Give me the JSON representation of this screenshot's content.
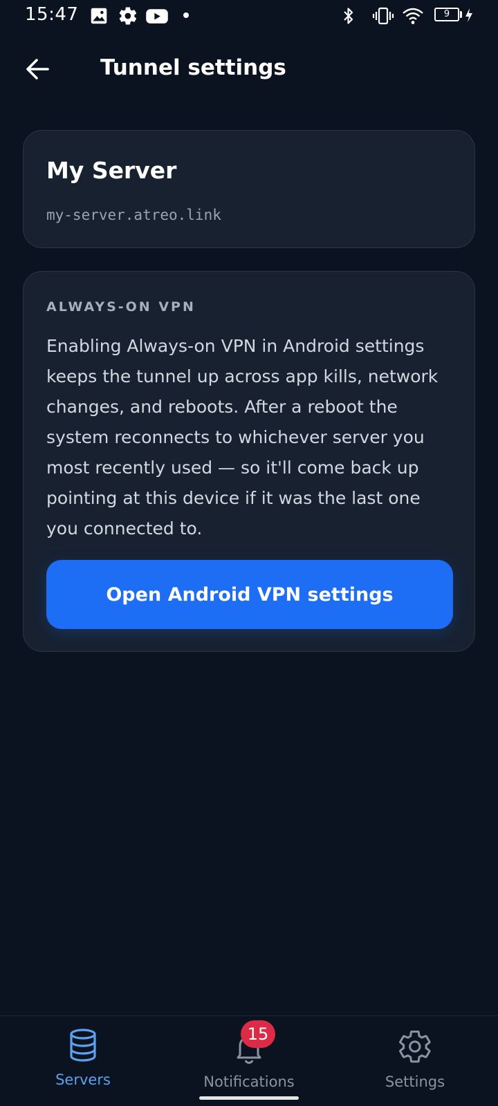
{
  "status_bar": {
    "time": "15:47",
    "battery_level": "9",
    "left_icons": [
      "image-icon",
      "gear-icon",
      "youtube-icon",
      "dot-icon"
    ],
    "right_icons": [
      "bluetooth-icon",
      "vibrate-icon",
      "wifi-icon",
      "battery-icon",
      "charging-bolt-icon"
    ]
  },
  "app_bar": {
    "title": "Tunnel settings",
    "back_icon": "arrow-left-icon"
  },
  "server_card": {
    "name": "My Server",
    "host": "my-server.atreo.link"
  },
  "always_on_card": {
    "heading": "ALWAYS-ON VPN",
    "description": "Enabling Always-on VPN in Android settings keeps the tunnel up across app kills, network changes, and reboots. After a reboot the system reconnects to whichever server you most recently used — so it'll come back up pointing at this device if it was the last one you connected to.",
    "button_label": "Open Android VPN settings"
  },
  "bottom_nav": {
    "items": [
      {
        "label": "Servers",
        "icon": "database-icon",
        "active": true
      },
      {
        "label": "Notifications",
        "icon": "bell-icon",
        "badge": "15"
      },
      {
        "label": "Settings",
        "icon": "gear-icon"
      }
    ]
  },
  "colors": {
    "background": "#0c1320",
    "card": "#172130",
    "accent": "#1e6ef5",
    "active_nav": "#5ca2ee",
    "badge": "#dc2b47"
  }
}
